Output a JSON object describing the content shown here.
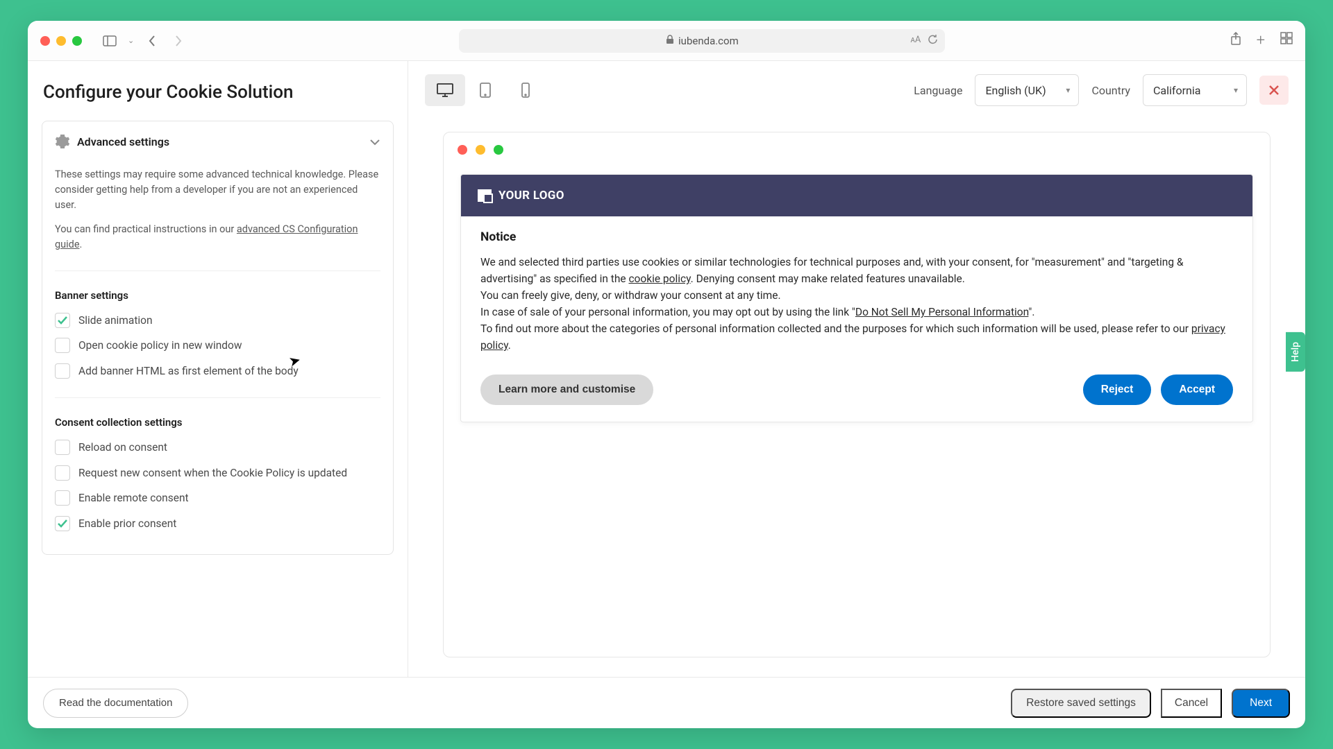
{
  "chrome": {
    "url_host": "iubenda.com"
  },
  "page": {
    "title": "Configure your Cookie Solution"
  },
  "advanced": {
    "title": "Advanced settings",
    "desc": "These settings may require some advanced technical knowledge. Please consider getting help from a developer if you are not an experienced user.",
    "guide_pre": "You can find practical instructions in our ",
    "guide_link": "advanced CS Configuration guide",
    "guide_post": "."
  },
  "banner_settings": {
    "title": "Banner settings",
    "slide": "Slide animation",
    "open_new": "Open cookie policy in new window",
    "add_html": "Add banner HTML as first element of the body"
  },
  "consent_settings": {
    "title": "Consent collection settings",
    "reload": "Reload on consent",
    "request_new": "Request new consent when the Cookie Policy is updated",
    "remote": "Enable remote consent",
    "prior": "Enable prior consent"
  },
  "toolbar": {
    "language_label": "Language",
    "language_value": "English (UK)",
    "country_label": "Country",
    "country_value": "California"
  },
  "preview": {
    "logo_text": "YOUR LOGO",
    "notice_title": "Notice",
    "p1a": "We and selected third parties use cookies or similar technologies for technical purposes and, with your consent, for \"measurement\" and \"targeting & advertising\" as specified in the ",
    "cookie_policy": "cookie policy",
    "p1b": ". Denying consent may make related features unavailable.",
    "p2": "You can freely give, deny, or withdraw your consent at any time.",
    "p3a": "In case of sale of your personal information, you may opt out by using the link \"",
    "do_not_sell": "Do Not Sell My Personal Information",
    "p3b": "\".",
    "p4a": "To find out more about the categories of personal information collected and the purposes for which such information will be used, please refer to our ",
    "privacy_policy": "privacy policy",
    "p4b": ".",
    "learn_btn": "Learn more and customise",
    "reject_btn": "Reject",
    "accept_btn": "Accept"
  },
  "help_tab": "Help",
  "footer": {
    "read_docs": "Read the documentation",
    "restore": "Restore saved settings",
    "cancel": "Cancel",
    "next": "Next"
  }
}
